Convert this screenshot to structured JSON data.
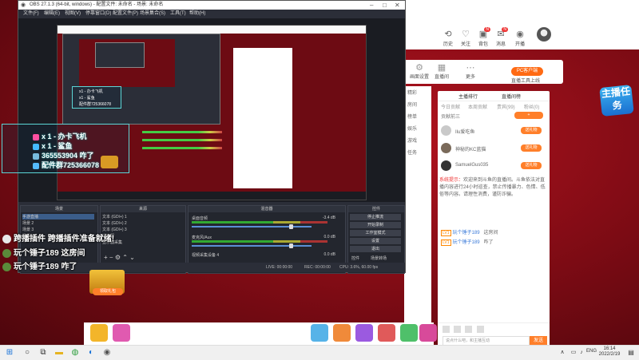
{
  "site": {
    "top_icons": [
      {
        "icon": "history-icon",
        "label": "历史"
      },
      {
        "icon": "follow-icon",
        "label": "关注"
      },
      {
        "icon": "bag-icon",
        "label": "背包"
      },
      {
        "icon": "msg-icon",
        "label": "消息"
      },
      {
        "icon": "live-icon",
        "label": "开播"
      }
    ],
    "tool_panel": [
      {
        "icon": "camera-icon",
        "label": "画面设置"
      },
      {
        "icon": "anchor-icon",
        "label": "直播间"
      },
      {
        "icon": "more-icon",
        "label": "更多"
      }
    ],
    "pc_button": "PC客户端",
    "pc_note": "直播工具上线",
    "sidebar": [
      "精彩",
      "房间",
      "榜单",
      "娱乐",
      "游戏",
      "任务"
    ],
    "task_badge": "主播任务",
    "chat": {
      "tabs": [
        "主播排行",
        "直播间榜"
      ],
      "subtabs": [
        "今日贡献",
        "本周贡献",
        "贵宾(99)",
        "粉丝(0)"
      ],
      "intro": "贡献前三",
      "rank": [
        {
          "name": "Ilu爱吃鱼",
          "badge": "送礼物"
        },
        {
          "name": "神秘的KC蓝猫",
          "badge": "送礼物"
        },
        {
          "name": "SamuelGus035",
          "badge": "送礼物"
        }
      ],
      "system_tag": "系统提示：",
      "system_msg": "欢迎来到斗鱼的直播间。斗鱼依法对直播内容进行24小时巡查，禁止传播暴力、色情、低俗等内容。请理性消费，谨防诈骗。",
      "messages": [
        {
          "lv": "LV1",
          "user": "玩个锤子189",
          "text": "这房间"
        },
        {
          "lv": "LV1",
          "user": "玩个锤子189",
          "text": "咋了"
        }
      ],
      "input_placeholder": "说点什么吧，和主播互动",
      "send_label": "发送"
    }
  },
  "obs": {
    "title": "OBS 27.1.3 (64-bit, windows) - 配置文件: 未命名 - 场景: 未命名",
    "menu": [
      "文件(F)",
      "编辑(E)",
      "视图(V)",
      "停靠窗口(D)",
      "配置文件(P)",
      "场景集合(S)",
      "工具(T)",
      "帮助(H)"
    ],
    "docks": {
      "scenes_header": "场景",
      "scenes": [
        "手游直播",
        "场景 2",
        "场景 3",
        "场景 4"
      ],
      "sources_header": "来源",
      "sources": [
        "文本 (GDI+) 1",
        "文本 (GDI+) 2",
        "文本 (GDI+) 3",
        "浏览器",
        "显示器采集"
      ],
      "mixer_header": "混音器",
      "mixer": [
        {
          "name": "桌面音频",
          "db": "-3.4 dB"
        },
        {
          "name": "麦克风/Aux",
          "db": "0.0 dB"
        },
        {
          "name": "视频采集设备 4",
          "db": "0.0 dB"
        }
      ],
      "controls_header": "控件",
      "controls": [
        "停止推流",
        "开始录制",
        "工作室模式",
        "设置",
        "退出"
      ],
      "tabs": [
        "控件",
        "场景转场"
      ]
    },
    "status": {
      "live": "LIVE: 00:00:00",
      "rec": "REC: 00:00:00",
      "cpu": "CPU: 3.6%, 60.00 fps"
    }
  },
  "overlay": {
    "gift_rows": [
      {
        "text": "x 1 - 办卡飞机",
        "color": "#ff4fa0"
      },
      {
        "text": "x 1 - 鲨鱼",
        "color": "#44b9ff"
      },
      {
        "text": "365553904 咋了",
        "color": "#ffffff"
      },
      {
        "text": "配件群725366078",
        "color": "#ffffff"
      }
    ],
    "small_rows": [
      "x1 - 办卡飞机",
      "x1 - 鲨鱼",
      "配件群725366078"
    ],
    "messages": [
      {
        "avatar": "default",
        "text": "跨播插件 跨播插件准备就绪!"
      },
      {
        "avatar": "green",
        "text": "玩个锤子189 这房间"
      },
      {
        "avatar": "green",
        "text": "玩个锤子189 咋了"
      }
    ],
    "gift_pkg_btn": "领取礼包"
  },
  "taskbar": {
    "icons": [
      "windows-icon",
      "search-icon",
      "taskview-icon",
      "explorer-icon",
      "chrome-icon",
      "edge-icon",
      "cortana-icon",
      "obs-icon"
    ],
    "lang": "ENG",
    "time": "16:14",
    "date": "2022/2/19"
  }
}
